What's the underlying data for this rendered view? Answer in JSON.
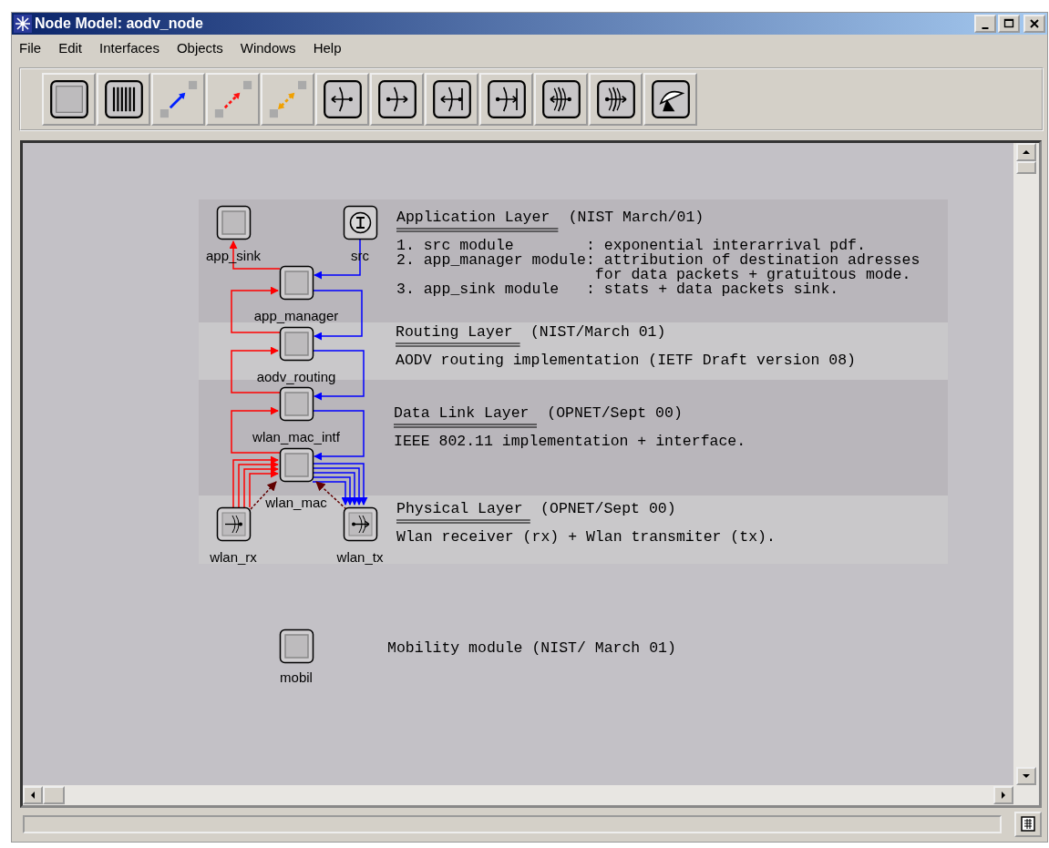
{
  "window": {
    "title": "Node Model: aodv_node"
  },
  "menu": [
    "File",
    "Edit",
    "Interfaces",
    "Objects",
    "Windows",
    "Help"
  ],
  "toolbar": [
    {
      "kind": "queue"
    },
    {
      "kind": "multi"
    },
    {
      "kind": "stream"
    },
    {
      "kind": "statwire"
    },
    {
      "kind": "logical"
    },
    {
      "kind": "p2p_rx"
    },
    {
      "kind": "p2p_tx"
    },
    {
      "kind": "bus_rx"
    },
    {
      "kind": "bus_tx"
    },
    {
      "kind": "radio_rx"
    },
    {
      "kind": "radio_tx"
    },
    {
      "kind": "antenna"
    }
  ],
  "layers": [
    {
      "title": "Application Layer",
      "credit": "(NIST March/01)",
      "lines": [
        "1. src module        : exponential interarrival pdf.",
        "2. app_manager module: attribution of destination adresses",
        "                      for data packets + gratuitous mode.",
        "3. app_sink module   : stats + data packets sink."
      ]
    },
    {
      "title": "Routing Layer",
      "credit": "(NIST/March 01)",
      "lines": [
        "AODV routing implementation (IETF Draft version 08)"
      ]
    },
    {
      "title": "Data Link Layer",
      "credit": "(OPNET/Sept 00)",
      "lines": [
        "IEEE 802.11 implementation + interface."
      ]
    },
    {
      "title": "Physical Layer",
      "credit": "(OPNET/Sept 00)",
      "lines": [
        "Wlan receiver (rx) + Wlan transmiter (tx)."
      ]
    }
  ],
  "nodes": [
    {
      "label": "app_sink",
      "kind": "queue"
    },
    {
      "label": "src",
      "kind": "source"
    },
    {
      "label": "app_manager",
      "kind": "queue"
    },
    {
      "label": "aodv_routing",
      "kind": "queue"
    },
    {
      "label": "wlan_mac_intf",
      "kind": "queue"
    },
    {
      "label": "wlan_mac",
      "kind": "queue"
    },
    {
      "label": "wlan_rx",
      "kind": "receiver"
    },
    {
      "label": "wlan_tx",
      "kind": "transmitter"
    },
    {
      "label": "mobil",
      "kind": "queue"
    }
  ],
  "note": "Mobility module  (NIST/ March 01)"
}
